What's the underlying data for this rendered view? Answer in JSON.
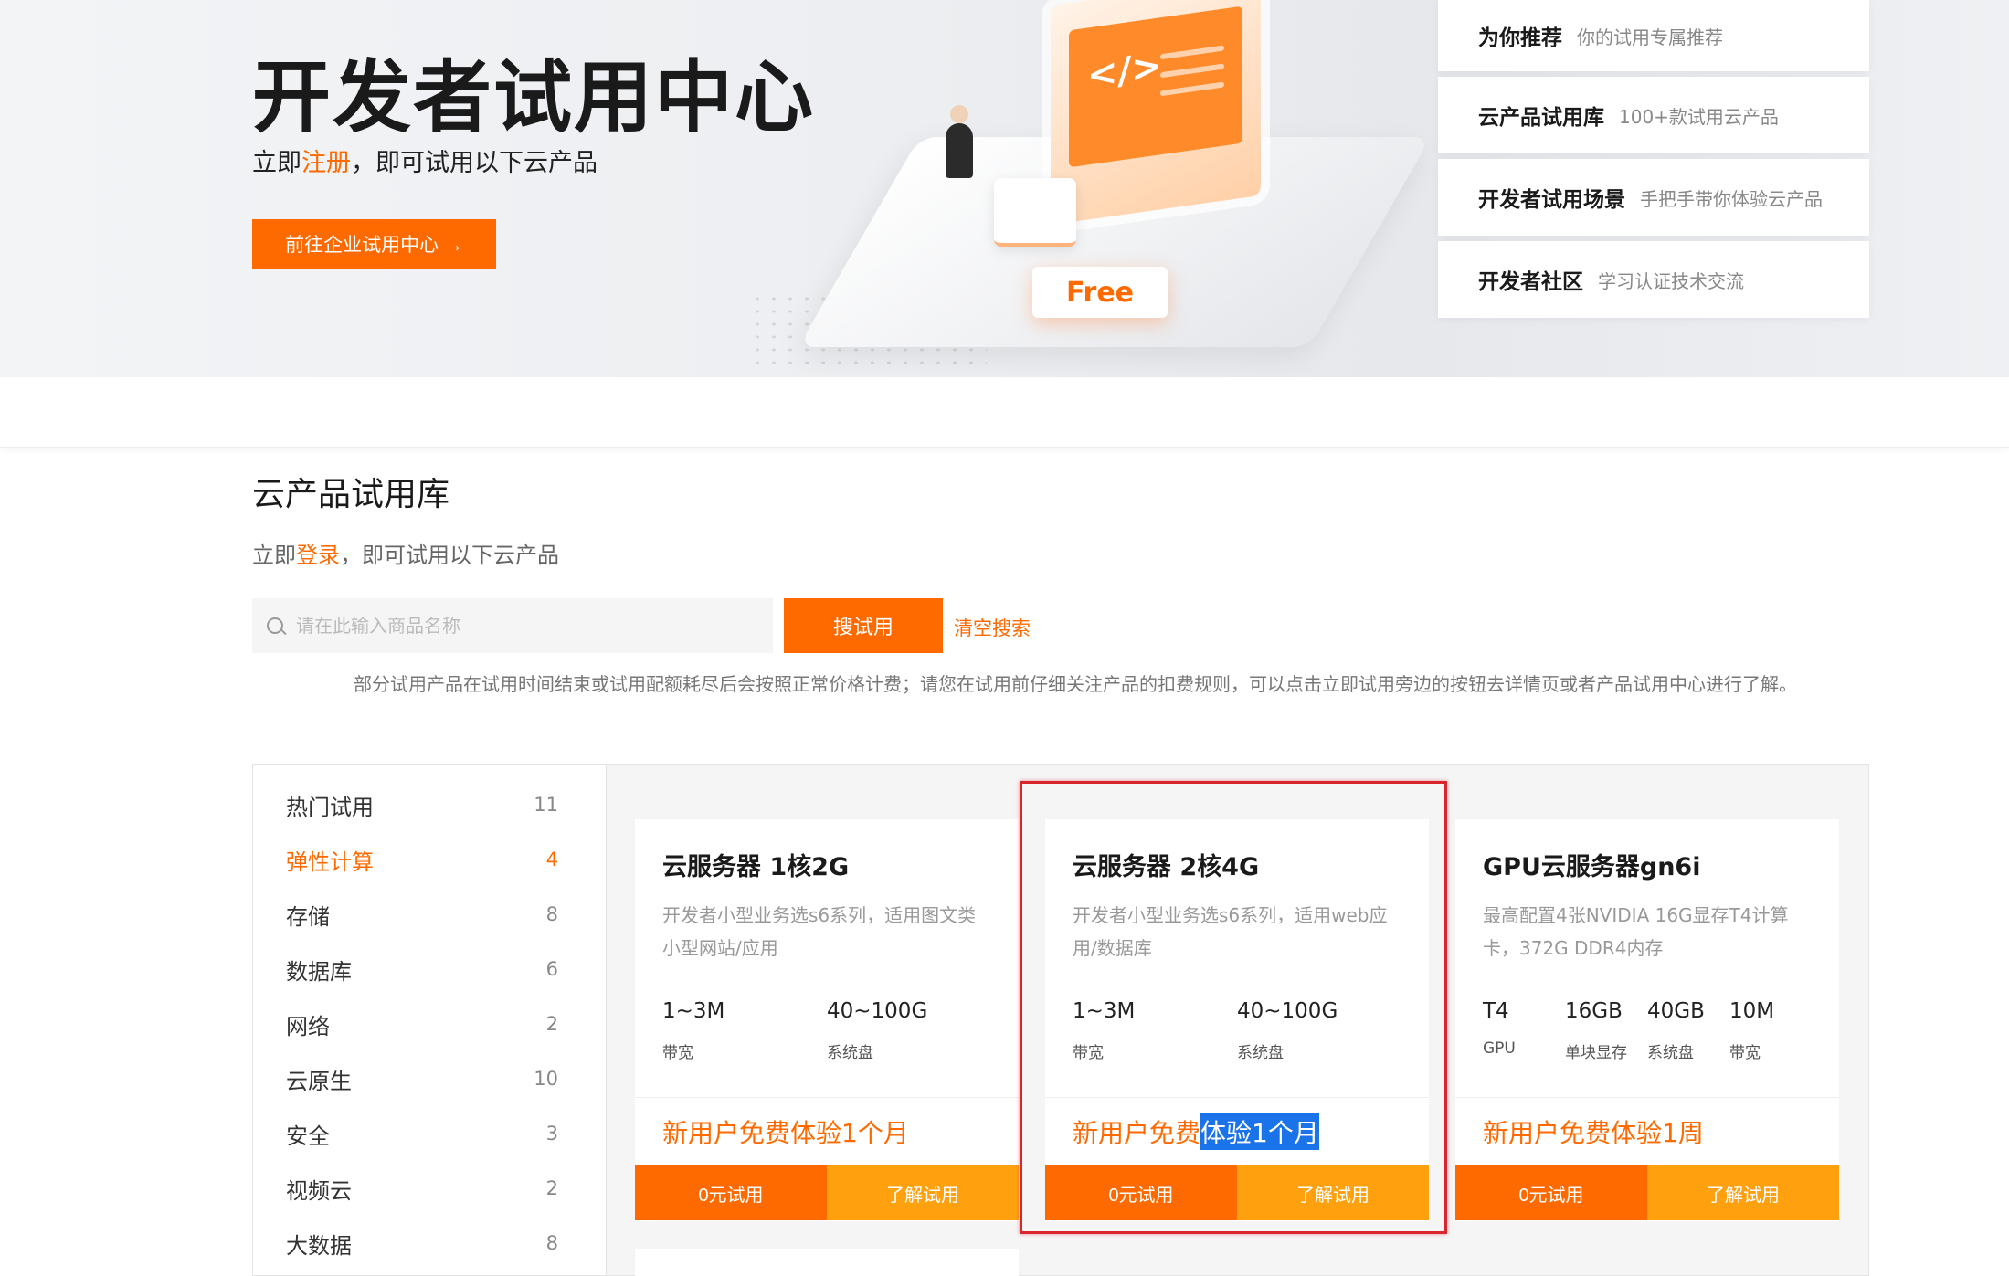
{
  "hero": {
    "title": "开发者试用中心",
    "sub_prefix": "立即",
    "sub_link": "注册",
    "sub_suffix": "，即可试用以下云产品",
    "button": "前往企业试用中心 →",
    "badge": "Free",
    "code_tag": "</>"
  },
  "side_menu": [
    {
      "title": "为你推荐",
      "desc": "你的试用专属推荐"
    },
    {
      "title": "云产品试用库",
      "desc": "100+款试用云产品"
    },
    {
      "title": "开发者试用场景",
      "desc": "手把手带你体验云产品"
    },
    {
      "title": "开发者社区",
      "desc": "学习认证技术交流"
    }
  ],
  "library": {
    "title": "云产品试用库",
    "sub_prefix": "立即",
    "sub_link": "登录",
    "sub_suffix": "，即可试用以下云产品",
    "search_placeholder": "请在此输入商品名称",
    "search_button": "搜试用",
    "clear_link": "清空搜索",
    "notice": "部分试用产品在试用时间结束或试用配额耗尽后会按照正常价格计费；请您在试用前仔细关注产品的扣费规则，可以点击立即试用旁边的按钮去详情页或者产品试用中心进行了解。"
  },
  "categories": [
    {
      "name": "热门试用",
      "count": "11"
    },
    {
      "name": "弹性计算",
      "count": "4"
    },
    {
      "name": "存储",
      "count": "8"
    },
    {
      "name": "数据库",
      "count": "6"
    },
    {
      "name": "网络",
      "count": "2"
    },
    {
      "name": "云原生",
      "count": "10"
    },
    {
      "name": "安全",
      "count": "3"
    },
    {
      "name": "视频云",
      "count": "2"
    },
    {
      "name": "大数据",
      "count": "8"
    }
  ],
  "active_category": "弹性计算",
  "cards": [
    {
      "title": "云服务器 1核2G",
      "desc": "开发者小型业务选s6系列，适用图文类小型网站/应用",
      "specs": [
        {
          "value": "1~3M",
          "label": "带宽"
        },
        {
          "value": "40~100G",
          "label": "系统盘"
        }
      ],
      "promo": "新用户免费体验1个月",
      "btn_try": "0元试用",
      "btn_learn": "了解试用"
    },
    {
      "title": "云服务器 2核4G",
      "desc": "开发者小型业务选s6系列，适用web应用/数据库",
      "specs": [
        {
          "value": "1~3M",
          "label": "带宽"
        },
        {
          "value": "40~100G",
          "label": "系统盘"
        }
      ],
      "promo_plain": "新用户免费",
      "promo_selected": "体验1个月",
      "btn_try": "0元试用",
      "btn_learn": "了解试用"
    },
    {
      "title": "GPU云服务器gn6i",
      "desc": "最高配置4张NVIDIA 16G显存T4计算卡，372G DDR4内存",
      "specs": [
        {
          "value": "T4",
          "label": "GPU"
        },
        {
          "value": "16GB",
          "label": "单块显存"
        },
        {
          "value": "40GB",
          "label": "系统盘"
        },
        {
          "value": "10M",
          "label": "带宽"
        }
      ],
      "promo": "新用户免费体验1周",
      "btn_try": "0元试用",
      "btn_learn": "了解试用"
    }
  ],
  "colors": {
    "accent": "#ff6a00",
    "accent_light": "#ffa10f",
    "highlight": "#d9262c",
    "selection": "#1a73e8"
  }
}
